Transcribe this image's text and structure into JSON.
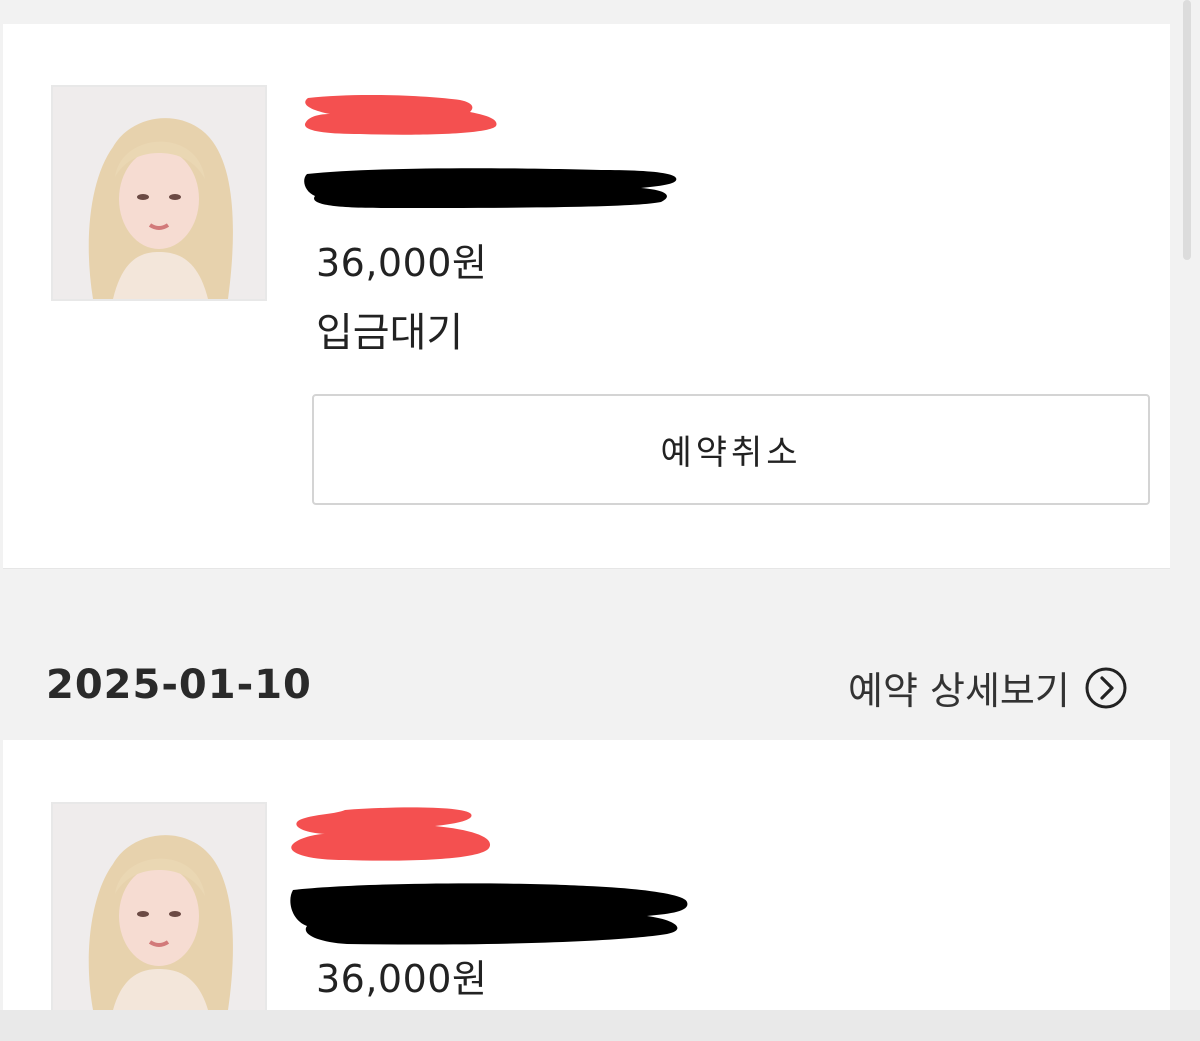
{
  "reservations": [
    {
      "price": "36,000원",
      "status": "입금대기",
      "cancel_label": "예약취소"
    },
    {
      "price": "36,000원"
    }
  ],
  "section": {
    "date": "2025-01-10",
    "detail_label": "예약 상세보기"
  },
  "icons": {
    "detail": "chevron-right-circle-icon"
  },
  "colors": {
    "redaction_red": "#f45050",
    "redaction_black": "#000000",
    "background": "#f2f2f2",
    "card": "#ffffff"
  }
}
